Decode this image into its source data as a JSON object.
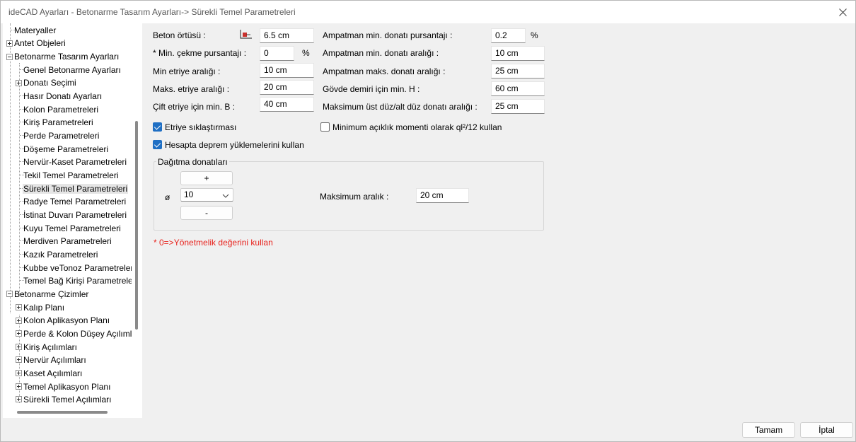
{
  "window": {
    "title": "ideCAD Ayarları - Betonarme Tasarım Ayarları-> Sürekli Temel Parametreleri"
  },
  "tree": {
    "items": [
      {
        "label": "Materyaller"
      },
      {
        "label": "Antet Objeleri"
      },
      {
        "label": "Betonarme Tasarım Ayarları"
      },
      {
        "label": "Genel Betonarme Ayarları"
      },
      {
        "label": "Donatı Seçimi"
      },
      {
        "label": "Hasır Donatı Ayarları"
      },
      {
        "label": "Kolon Parametreleri"
      },
      {
        "label": "Kiriş Parametreleri"
      },
      {
        "label": "Perde Parametreleri"
      },
      {
        "label": "Döşeme Parametreleri"
      },
      {
        "label": "Nervür-Kaset Parametreleri"
      },
      {
        "label": "Tekil Temel Parametreleri"
      },
      {
        "label": "Sürekli Temel Parametreleri"
      },
      {
        "label": "Radye Temel Parametreleri"
      },
      {
        "label": "İstinat Duvarı Parametreleri"
      },
      {
        "label": "Kuyu Temel Parametreleri"
      },
      {
        "label": "Merdiven Parametreleri"
      },
      {
        "label": "Kazık Parametreleri"
      },
      {
        "label": "Kubbe veTonoz Parametreler"
      },
      {
        "label": "Temel Bağ Kirişi Parametreler"
      },
      {
        "label": "Betonarme Çizimler"
      },
      {
        "label": "Kalıp Planı"
      },
      {
        "label": "Kolon Aplikasyon Planı"
      },
      {
        "label": "Perde & Kolon Düşey Açılıml"
      },
      {
        "label": "Kiriş Açılımları"
      },
      {
        "label": "Nervür Açılımları"
      },
      {
        "label": "Kaset Açılımları"
      },
      {
        "label": "Temel Aplikasyon Planı"
      },
      {
        "label": "Sürekli Temel Açılımları"
      }
    ]
  },
  "form": {
    "beton_ortusu": {
      "label": "Beton örtüsü :",
      "value": "6.5 cm"
    },
    "min_cekme": {
      "label": "* Min. çekme pursantajı :",
      "value": "0",
      "unit": "%"
    },
    "min_etriye": {
      "label": "Min etriye aralığı :",
      "value": "10 cm"
    },
    "maks_etriye": {
      "label": "Maks. etriye aralığı :",
      "value": "20 cm"
    },
    "cift_etriye": {
      "label": "Çift etriye için min. B :",
      "value": "40 cm"
    },
    "ampatman_min_pursantaj": {
      "label": "Ampatman min. donatı pursantajı :",
      "value": "0.2",
      "unit": "%"
    },
    "ampatman_min_aralik": {
      "label": "Ampatman min. donatı aralığı :",
      "value": "10 cm"
    },
    "ampatman_maks_aralik": {
      "label": "Ampatman maks. donatı aralığı :",
      "value": "25 cm"
    },
    "govde_demiri": {
      "label": "Gövde demiri için min. H :",
      "value": "60 cm"
    },
    "maks_ust_alt": {
      "label": "Maksimum üst düz/alt düz donatı aralığı :",
      "value": "25 cm"
    },
    "etriye_siklastirmasi": {
      "label": "Etriye sıklaştırması",
      "checked": true
    },
    "deprem_yuklemeleri": {
      "label": "Hesapta deprem yüklemelerini kullan",
      "checked": true
    },
    "minimum_aciklik": {
      "label": "Minimum açıklık momenti olarak ql²/12 kullan",
      "checked": false
    },
    "dagitma": {
      "title": "Dağıtma donatıları",
      "plus_label": "+",
      "minus_label": "-",
      "phi_label": "ø",
      "phi_value": "10",
      "maks_aralik_label": "Maksimum aralık :",
      "maks_aralik_value": "20 cm"
    },
    "note": "* 0=>Yönetmelik değerini kullan"
  },
  "footer": {
    "ok_label": "Tamam",
    "cancel_label": "İptal"
  },
  "colors": {
    "accent": "#1f6fc4",
    "note": "#e8231d"
  }
}
